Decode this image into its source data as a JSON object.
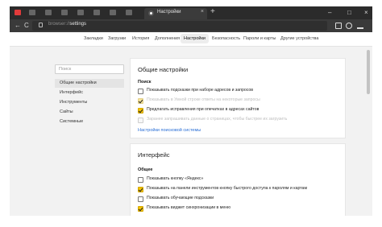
{
  "browser": {
    "active_tab_title": "Настройки",
    "url_prefix": "browser://",
    "url_path": "settings",
    "new_tab_glyph": "+",
    "tab_close_glyph": "×",
    "window_controls": [
      "–",
      "□",
      "×"
    ],
    "nav_glyphs": {
      "back": "←",
      "reload": "C"
    }
  },
  "topnav": {
    "items": [
      {
        "label": "Закладки"
      },
      {
        "label": "Загрузки"
      },
      {
        "label": "История"
      },
      {
        "label": "Дополнения"
      },
      {
        "label": "Настройки",
        "active": true
      },
      {
        "label": "Безопасность"
      },
      {
        "label": "Пароли и карты"
      },
      {
        "label": "Другие устройства"
      }
    ]
  },
  "sidebar": {
    "search_placeholder": "Поиск",
    "items": [
      {
        "label": "Общие настройки",
        "active": true
      },
      {
        "label": "Интерфейс"
      },
      {
        "label": "Инструменты"
      },
      {
        "label": "Сайты"
      },
      {
        "label": "Системные"
      }
    ]
  },
  "general": {
    "title": "Общие настройки",
    "search_label": "Поиск",
    "options": [
      {
        "label": "Показывать подсказки при наборе адресов и запросов",
        "checked": false,
        "disabled": false
      },
      {
        "label": "Показывать в Умной строке ответы на некоторые запросы",
        "checked": true,
        "disabled": true
      },
      {
        "label": "Предлагать исправления при опечатках в адресах сайтов",
        "checked": true,
        "disabled": false
      },
      {
        "label": "Заранее запрашивать данные о страницах, чтобы быстрее их загрузить",
        "checked": false,
        "disabled": true
      }
    ],
    "search_engine_link": "Настройки поисковой системы"
  },
  "interface": {
    "title": "Интерфейс",
    "section_label": "Общее",
    "options": [
      {
        "label": "Показывать кнопку «Яндекс»",
        "checked": false
      },
      {
        "label": "Показывать на панели инструментов кнопку быстрого доступа к паролям и картам",
        "checked": true
      },
      {
        "label": "Показывать обучающие подсказки",
        "checked": false
      },
      {
        "label": "Показывать виджет синхронизации в меню",
        "checked": true
      }
    ]
  },
  "colors": {
    "accent": "#f5c400",
    "link": "#2a6fd6",
    "tabbar": "#2b2b2b"
  }
}
